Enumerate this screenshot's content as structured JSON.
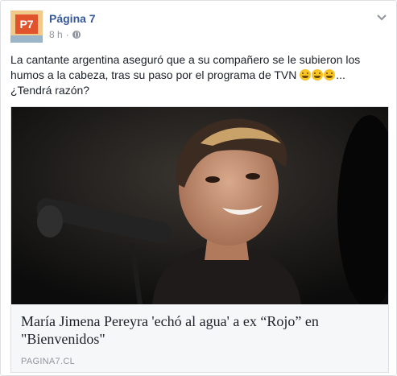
{
  "post": {
    "page_name": "Página 7",
    "timestamp": "8 h",
    "separator": "·",
    "avatar_text": "P7",
    "text_before_emoji": "La cantante argentina aseguró que a su compañero se le subieron los humos a la cabeza, tras su paso por el programa de TVN ",
    "text_after_emoji": "... ¿Tendrá razón?",
    "emoji_count": 3,
    "emoji_icon": "grinning-face-icon"
  },
  "link": {
    "title": "María Jimena Pereyra 'echó al agua' a ex “Rojo” en \"Bienvenidos\"",
    "domain": "PAGINA7.CL"
  },
  "colors": {
    "page_name": "#365899",
    "meta": "#90949c",
    "card_bg": "#f6f7f9"
  }
}
